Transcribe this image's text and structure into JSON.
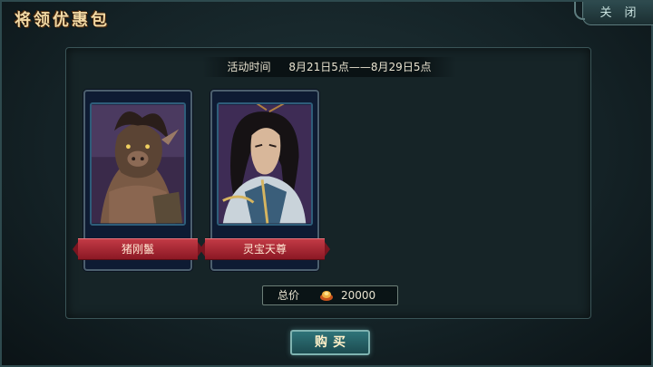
{
  "window": {
    "title": "将领优惠包",
    "close_label": "关闭"
  },
  "activity": {
    "time_label": "活动时间",
    "time_range": "8月21日5点——8月29日5点"
  },
  "cards": [
    {
      "name": "猪刚鬣",
      "portrait_icon": "boar-warrior-portrait"
    },
    {
      "name": "灵宝天尊",
      "portrait_icon": "taoist-immortal-portrait"
    }
  ],
  "price": {
    "label": "总价",
    "currency_icon": "ingot-coin-icon",
    "value": "20000"
  },
  "buy": {
    "label": "购买"
  },
  "colors": {
    "ribbon": "#a82530",
    "accent_text": "#f3d9a4",
    "button": "#2f7479"
  }
}
